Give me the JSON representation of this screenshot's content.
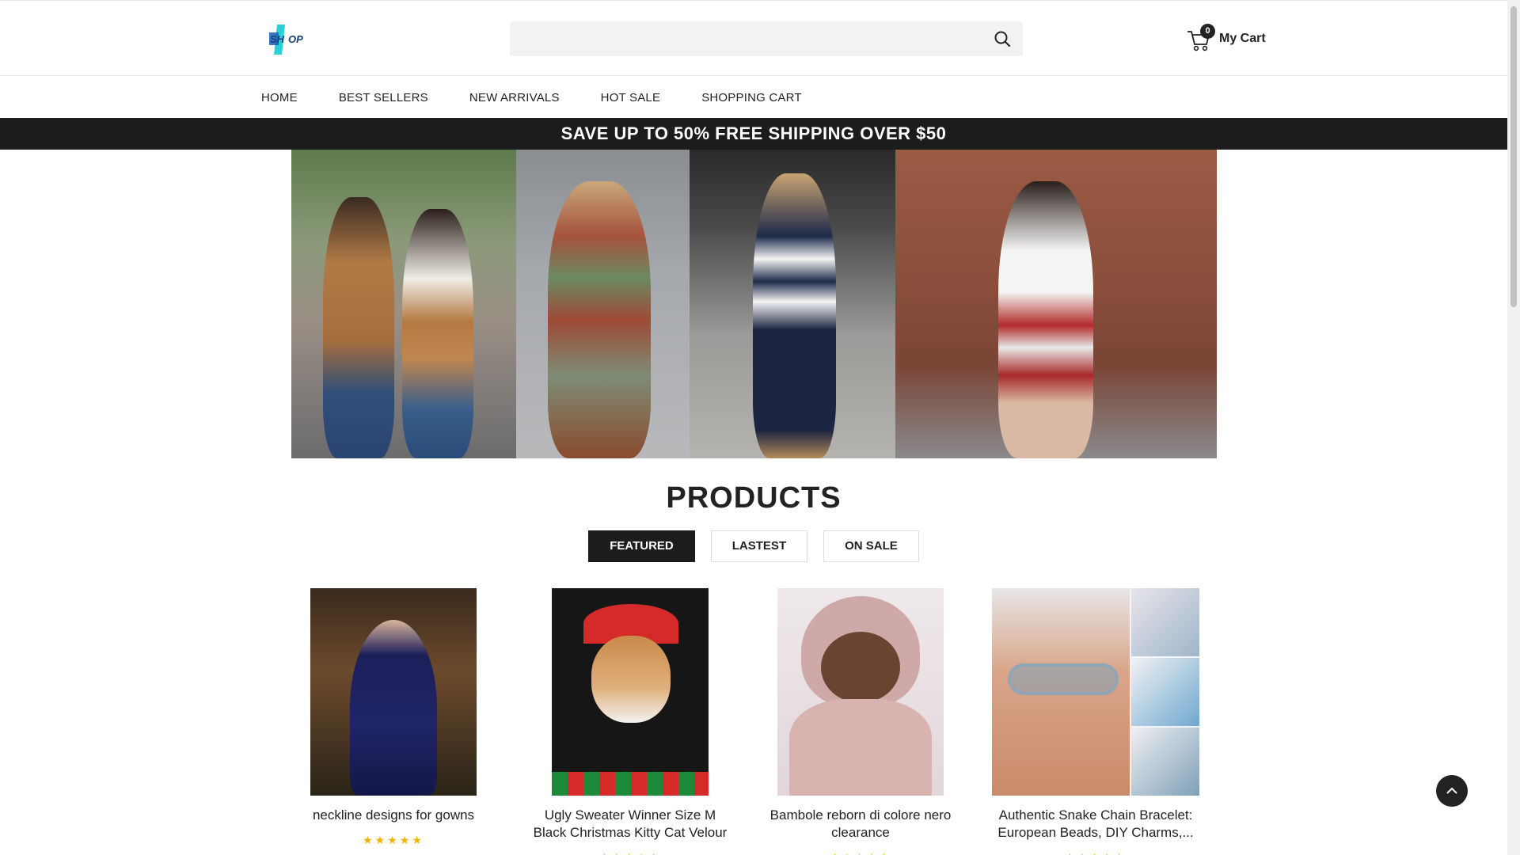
{
  "header": {
    "logo_text": "SHOP",
    "search": {
      "placeholder": "",
      "value": ""
    },
    "cart": {
      "count": "0",
      "label": "My Cart"
    }
  },
  "nav": {
    "items": [
      {
        "label": "HOME"
      },
      {
        "label": "BEST SELLERS"
      },
      {
        "label": "NEW ARRIVALS"
      },
      {
        "label": "HOT SALE"
      },
      {
        "label": "SHOPPING CART"
      }
    ]
  },
  "promo": {
    "text": "SAVE UP TO 50% FREE SHIPPING OVER $50"
  },
  "products_section": {
    "title": "PRODUCTS",
    "tabs": [
      {
        "label": "FEATURED",
        "active": true
      },
      {
        "label": "LASTEST",
        "active": false
      },
      {
        "label": "ON SALE",
        "active": false
      }
    ],
    "items": [
      {
        "name": "neckline designs for gowns",
        "rating": "★★★★★"
      },
      {
        "name": "Ugly Sweater Winner Size M Black Christmas Kitty Cat Velour",
        "rating": "★★★★★"
      },
      {
        "name": "Bambole reborn di colore nero clearance",
        "rating": "★★★★★"
      },
      {
        "name": "Authentic Snake Chain Bracelet: European Beads, DIY Charms,...",
        "rating": "★★★★★"
      }
    ]
  },
  "colors": {
    "accent": "#1c1c1c",
    "logo_blue": "#1a5fb4",
    "logo_cyan": "#2ad0d6",
    "star": "#f5b301"
  },
  "icons": {
    "search": "search-icon",
    "cart": "cart-icon",
    "scroll_top": "chevron-up-icon"
  }
}
